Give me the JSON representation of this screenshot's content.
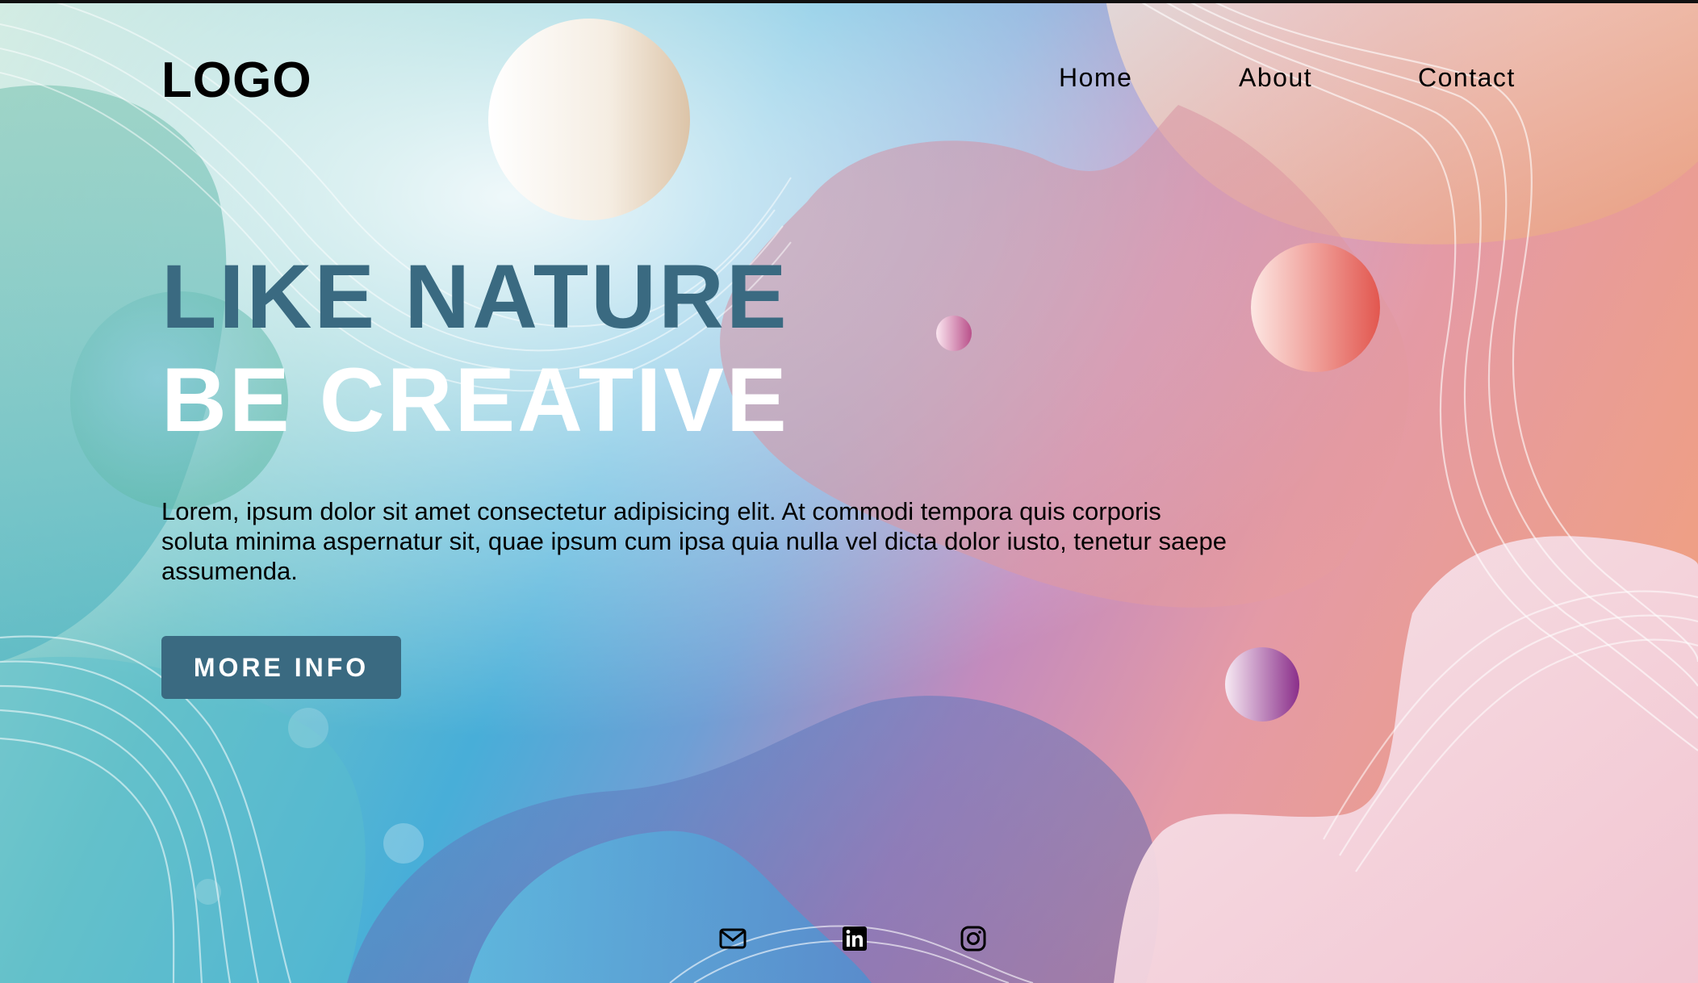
{
  "header": {
    "logo": "LOGO",
    "nav": [
      {
        "label": "Home"
      },
      {
        "label": "About"
      },
      {
        "label": "Contact"
      }
    ]
  },
  "hero": {
    "line1": "LIKE NATURE",
    "line2": "BE CREATIVE",
    "paragraph": "Lorem, ipsum dolor sit amet consectetur adipisicing elit. At commodi tempora quis corporis soluta minima aspernatur sit, quae ipsum cum ipsa quia nulla vel dicta dolor iusto, tenetur saepe assumenda.",
    "button_label": "MORE INFO"
  },
  "footer": {
    "icons": [
      "mail-icon",
      "linkedin-icon",
      "instagram-icon"
    ]
  },
  "colors": {
    "accent": "#3a6a81",
    "text": "#000000",
    "heading_light": "#ffffff"
  }
}
